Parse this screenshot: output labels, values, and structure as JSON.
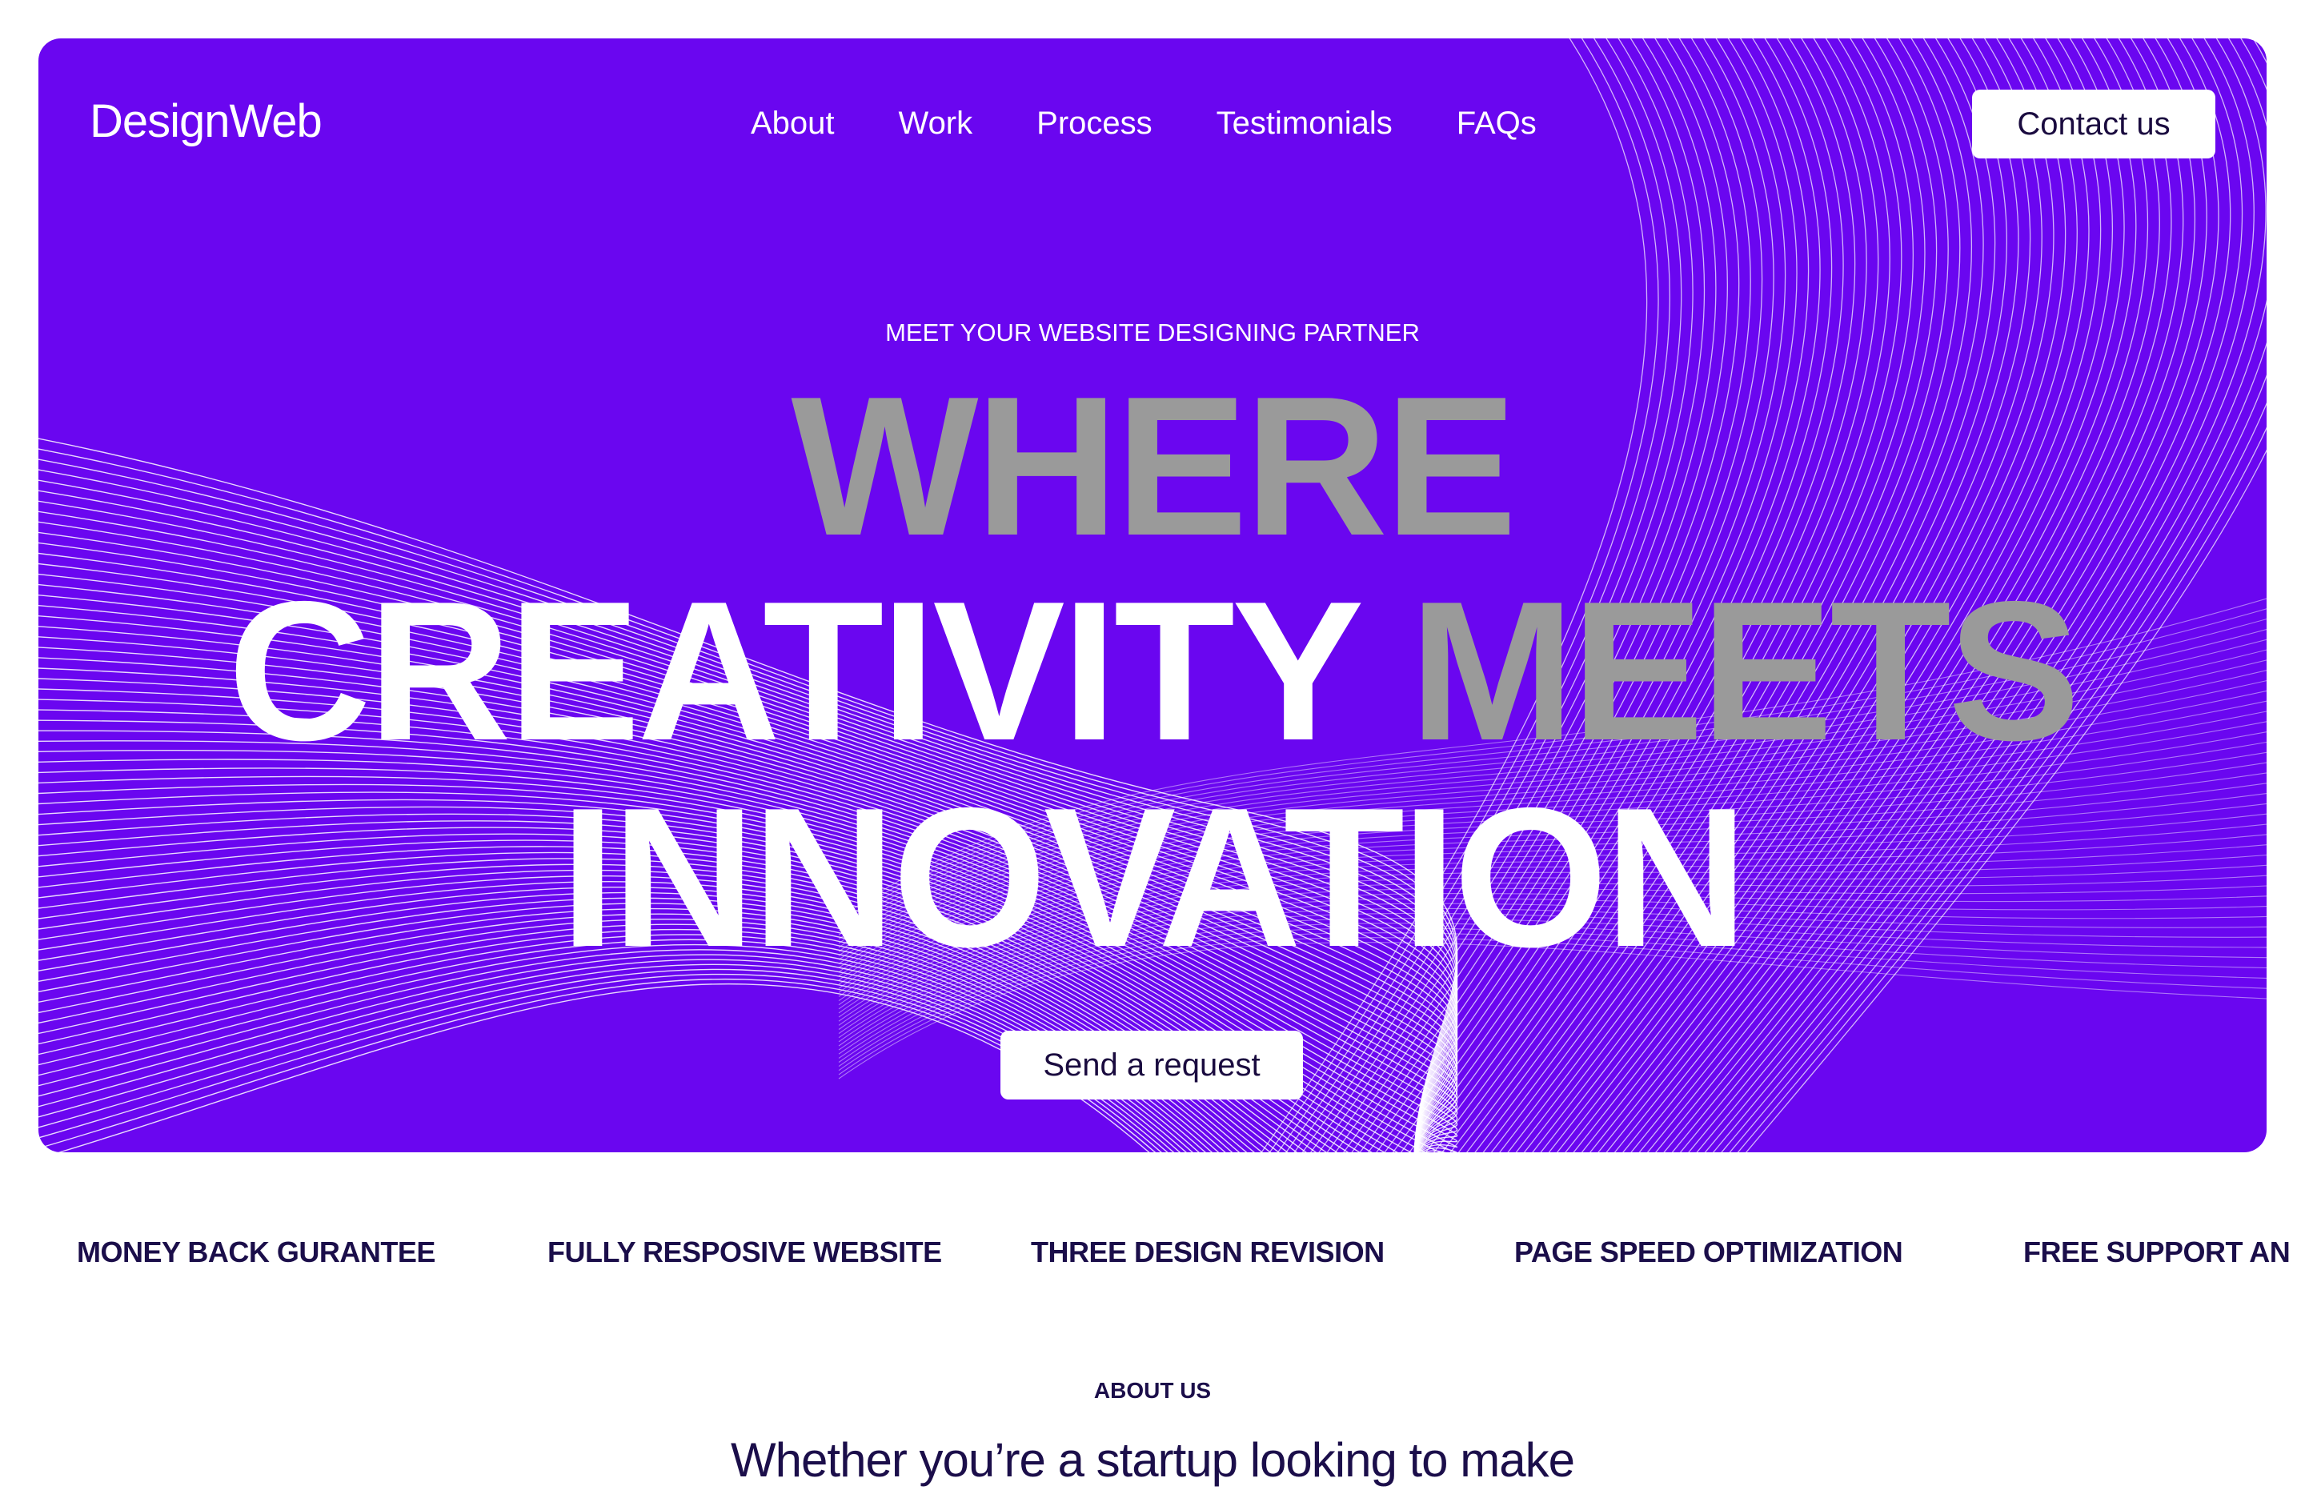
{
  "brand": {
    "logo": "DesignWeb"
  },
  "nav": {
    "items": [
      {
        "label": "About"
      },
      {
        "label": "Work"
      },
      {
        "label": "Process"
      },
      {
        "label": "Testimonials"
      },
      {
        "label": "FAQs"
      }
    ],
    "contact_label": "Contact us"
  },
  "hero": {
    "eyebrow": "MEET YOUR WEBSITE DESIGNING PARTNER",
    "line1": "WHERE",
    "line2_a": "CREATIVITY",
    "line2_b": "MEETS",
    "line3": "INNOVATION",
    "cta_label": "Send a request",
    "background_color": "#6a06f0",
    "highlight_color": "#9a9a9a"
  },
  "features": [
    "MONEY BACK GURANTEE",
    "FULLY RESPOSIVE WEBSITE",
    "THREE DESIGN REVISION",
    "PAGE SPEED OPTIMIZATION",
    "FREE SUPPORT AN"
  ],
  "about": {
    "label": "ABOUT US",
    "heading": "Whether you’re a startup looking to make"
  }
}
